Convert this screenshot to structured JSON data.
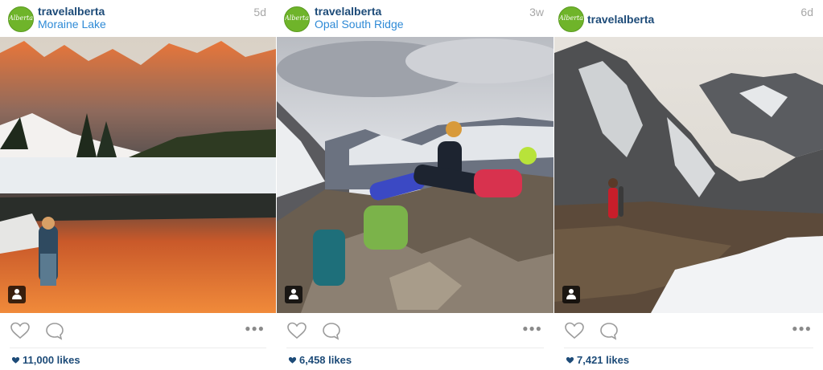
{
  "posts": [
    {
      "username": "travelalberta",
      "location": "Moraine Lake",
      "time": "5d",
      "likes": "11,000 likes",
      "avatar_text": "Alberta",
      "photo_subject": "Moraine Lake reflection with person in blanket"
    },
    {
      "username": "travelalberta",
      "location": "Opal South Ridge",
      "time": "3w",
      "likes": "6,458 likes",
      "avatar_text": "Alberta",
      "photo_subject": "Hikers resting on rocky ridge with backpacks"
    },
    {
      "username": "travelalberta",
      "location": "",
      "time": "6d",
      "likes": "7,421 likes",
      "avatar_text": "Alberta",
      "photo_subject": "Couple on mountain ridge with snow"
    }
  ],
  "icons": {
    "like": "heart-outline-icon",
    "comment": "speech-bubble-icon",
    "more": "ellipsis-icon",
    "tag": "person-tag-icon",
    "likes_count": "heart-filled-icon"
  },
  "colors": {
    "username": "#1d4b78",
    "location": "#2e8ad6",
    "timestamp": "#a7a7a7",
    "avatar": "#6fb42a"
  }
}
